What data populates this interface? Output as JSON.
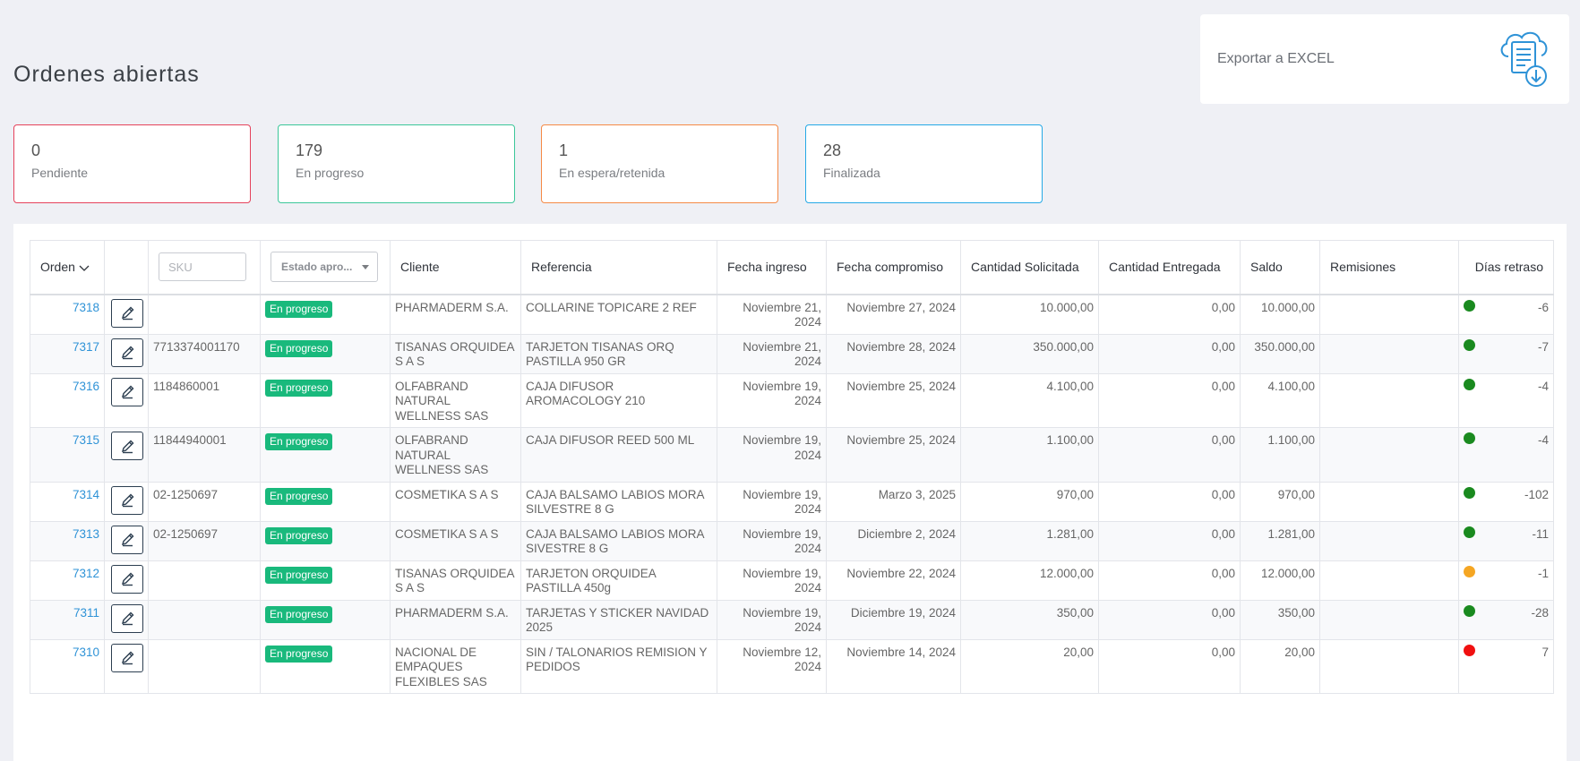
{
  "page": {
    "title": "Ordenes abiertas"
  },
  "export": {
    "label": "Exportar a EXCEL",
    "icon": "cloud-document-download-icon"
  },
  "stats": [
    {
      "value": "0",
      "label": "Pendiente",
      "color": "#e5425b"
    },
    {
      "value": "179",
      "label": "En progreso",
      "color": "#3cc79a"
    },
    {
      "value": "1",
      "label": "En espera/retenida",
      "color": "#f58a46"
    },
    {
      "value": "28",
      "label": "Finalizada",
      "color": "#25a9e6"
    }
  ],
  "table": {
    "headers": {
      "orden": "Orden",
      "cliente": "Cliente",
      "referencia": "Referencia",
      "fecha_ingreso": "Fecha ingreso",
      "fecha_compromiso": "Fecha compromiso",
      "cantidad_solicitada": "Cantidad Solicitada",
      "cantidad_entregada": "Cantidad Entregada",
      "saldo": "Saldo",
      "remisiones": "Remisiones",
      "dias_retraso": "Días retraso"
    },
    "sku_placeholder": "SKU",
    "estado_filter": "Estado apro...",
    "status_colors": {
      "green": "#1a8a1f",
      "orange": "#f5a623",
      "red": "#f01010"
    },
    "rows": [
      {
        "orden": "7318",
        "sku": "",
        "estado": "En progreso",
        "cliente": "PHARMADERM S.A.",
        "referencia": "COLLARINE TOPICARE 2 REF",
        "fecha_ingreso": "Noviembre 21, 2024",
        "fecha_compromiso": "Noviembre 27, 2024",
        "cantidad_solicitada": "10.000,00",
        "cantidad_entregada": "0,00",
        "saldo": "10.000,00",
        "remisiones": "",
        "status": "green",
        "dias_retraso": "-6"
      },
      {
        "orden": "7317",
        "sku": "7713374001170",
        "estado": "En progreso",
        "cliente": "TISANAS ORQUIDEA S A S",
        "referencia": "TARJETON TISANAS ORQ PASTILLA 950 GR",
        "fecha_ingreso": "Noviembre 21, 2024",
        "fecha_compromiso": "Noviembre 28, 2024",
        "cantidad_solicitada": "350.000,00",
        "cantidad_entregada": "0,00",
        "saldo": "350.000,00",
        "remisiones": "",
        "status": "green",
        "dias_retraso": "-7"
      },
      {
        "orden": "7316",
        "sku": "1184860001",
        "estado": "En progreso",
        "cliente": "OLFABRAND NATURAL WELLNESS SAS",
        "referencia": "CAJA DIFUSOR AROMACOLOGY 210",
        "fecha_ingreso": "Noviembre 19, 2024",
        "fecha_compromiso": "Noviembre 25, 2024",
        "cantidad_solicitada": "4.100,00",
        "cantidad_entregada": "0,00",
        "saldo": "4.100,00",
        "remisiones": "",
        "status": "green",
        "dias_retraso": "-4"
      },
      {
        "orden": "7315",
        "sku": "11844940001",
        "estado": "En progreso",
        "cliente": "OLFABRAND NATURAL WELLNESS SAS",
        "referencia": "CAJA DIFUSOR REED 500 ML",
        "fecha_ingreso": "Noviembre 19, 2024",
        "fecha_compromiso": "Noviembre 25, 2024",
        "cantidad_solicitada": "1.100,00",
        "cantidad_entregada": "0,00",
        "saldo": "1.100,00",
        "remisiones": "",
        "status": "green",
        "dias_retraso": "-4"
      },
      {
        "orden": "7314",
        "sku": "02-1250697",
        "estado": "En progreso",
        "cliente": "COSMETIKA S A S",
        "referencia": "CAJA BALSAMO LABIOS MORA SILVESTRE 8 G",
        "fecha_ingreso": "Noviembre 19, 2024",
        "fecha_compromiso": "Marzo 3, 2025",
        "cantidad_solicitada": "970,00",
        "cantidad_entregada": "0,00",
        "saldo": "970,00",
        "remisiones": "",
        "status": "green",
        "dias_retraso": "-102"
      },
      {
        "orden": "7313",
        "sku": "02-1250697",
        "estado": "En progreso",
        "cliente": "COSMETIKA S A S",
        "referencia": "CAJA BALSAMO LABIOS MORA SIVESTRE 8 G",
        "fecha_ingreso": "Noviembre 19, 2024",
        "fecha_compromiso": "Diciembre 2, 2024",
        "cantidad_solicitada": "1.281,00",
        "cantidad_entregada": "0,00",
        "saldo": "1.281,00",
        "remisiones": "",
        "status": "green",
        "dias_retraso": "-11"
      },
      {
        "orden": "7312",
        "sku": "",
        "estado": "En progreso",
        "cliente": "TISANAS ORQUIDEA S A S",
        "referencia": "TARJETON ORQUIDEA PASTILLA 450g",
        "fecha_ingreso": "Noviembre 19, 2024",
        "fecha_compromiso": "Noviembre 22, 2024",
        "cantidad_solicitada": "12.000,00",
        "cantidad_entregada": "0,00",
        "saldo": "12.000,00",
        "remisiones": "",
        "status": "orange",
        "dias_retraso": "-1"
      },
      {
        "orden": "7311",
        "sku": "",
        "estado": "En progreso",
        "cliente": "PHARMADERM S.A.",
        "referencia": "TARJETAS Y STICKER NAVIDAD 2025",
        "fecha_ingreso": "Noviembre 19, 2024",
        "fecha_compromiso": "Diciembre 19, 2024",
        "cantidad_solicitada": "350,00",
        "cantidad_entregada": "0,00",
        "saldo": "350,00",
        "remisiones": "",
        "status": "green",
        "dias_retraso": "-28"
      },
      {
        "orden": "7310",
        "sku": "",
        "estado": "En progreso",
        "cliente": "NACIONAL DE EMPAQUES FLEXIBLES SAS",
        "referencia": "SIN / TALONARIOS REMISION Y PEDIDOS",
        "fecha_ingreso": "Noviembre 12, 2024",
        "fecha_compromiso": "Noviembre 14, 2024",
        "cantidad_solicitada": "20,00",
        "cantidad_entregada": "0,00",
        "saldo": "20,00",
        "remisiones": "",
        "status": "red",
        "dias_retraso": "7"
      }
    ]
  }
}
